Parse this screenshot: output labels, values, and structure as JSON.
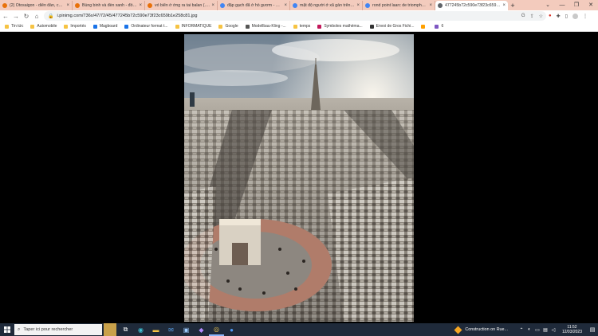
{
  "tabs": [
    {
      "title": "(2) Otosaigon - diễn đàn, cộng đ...",
      "fav": "#e8710a",
      "active": false
    },
    {
      "title": "Bùng binh và đèn xanh - đồ cũ...",
      "fav": "#e8710a",
      "active": false
    },
    {
      "title": "vỏ biển ở ớng ra tai balan (.) mục...",
      "fav": "#e8710a",
      "active": false
    },
    {
      "title": "đặp gạch đã ở hồ gươm - Rech...",
      "fav": "#4285f4",
      "active": false
    },
    {
      "title": "mặt độ người ở xã gần trên cả...",
      "fav": "#4285f4",
      "active": false
    },
    {
      "title": "rond point laarc de triomphe -...",
      "fav": "#4285f4",
      "active": false
    },
    {
      "title": "477245b72c590e73f23c659b1e...",
      "fav": "#5f6368",
      "active": true
    }
  ],
  "address_bar": {
    "url": "i.pinimg.com/736x/47/72/45/477245b72c590e73f23c659b1e258c81.jpg"
  },
  "bookmarks": [
    {
      "label": "Tin tức",
      "color": "#f6c343"
    },
    {
      "label": "Automobile",
      "color": "#f6c343"
    },
    {
      "label": "Importés",
      "color": "#f6c343"
    },
    {
      "label": "Magboard",
      "color": "#1a73e8"
    },
    {
      "label": "Ordinateur format t...",
      "color": "#1a73e8"
    },
    {
      "label": "INFORMATIQUE",
      "color": "#f6c343"
    },
    {
      "label": "Google",
      "color": "#f6c343"
    },
    {
      "label": "Modellbau-Kling -...",
      "color": "#555"
    },
    {
      "label": "temps",
      "color": "#f6c343"
    },
    {
      "label": "Symboles mathéma...",
      "color": "#c2185b"
    },
    {
      "label": "Envoi de Gros Fichi...",
      "color": "#333"
    },
    {
      "label": "",
      "color": "#ffa000"
    },
    {
      "label": "6",
      "color": "#7e57c2"
    }
  ],
  "taskbar": {
    "search_placeholder": "Taper ici pour rechercher",
    "weather": "Construction on Rue...",
    "time": "11:52",
    "date": "12/03/2023"
  },
  "colors": {
    "chrome_bg": "#f3cbbd",
    "taskbar_bg": "#1f2a3a"
  }
}
